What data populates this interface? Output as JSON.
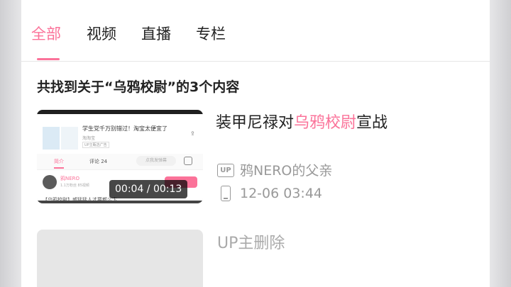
{
  "tabs": [
    {
      "label": "全部",
      "active": true
    },
    {
      "label": "视频",
      "active": false
    },
    {
      "label": "直播",
      "active": false
    },
    {
      "label": "专栏",
      "active": false
    }
  ],
  "accent_color": "#fb7299",
  "result_count": "共找到关于“乌鸦校尉”的3个内容",
  "results": [
    {
      "title_prefix": "装甲尼禄对",
      "title_highlight": "乌鸦校尉",
      "title_suffix": "宣战",
      "duration": "00:04 / 00:13",
      "uploader_icon": "up-badge-icon",
      "uploader": "鸦NERO的父亲",
      "date_icon": "phone-icon",
      "date": "12-06 03:44",
      "thumbnail": {
        "screen_title": "学生党千万别错过！淘宝太便宜了",
        "shop": "淘淘宝",
        "tag": "UP主甄选广告",
        "tab_intro": "简介",
        "tab_comments": "评论 24",
        "danmu_placeholder": "点我发弹幕",
        "up_name": "鸦NERO",
        "up_stats": "1.1万粉丝    85视频",
        "bottom_text": "【乌鸦校尉】威猛猛人才要都么卞"
      }
    },
    {
      "title": "UP主删除"
    }
  ]
}
